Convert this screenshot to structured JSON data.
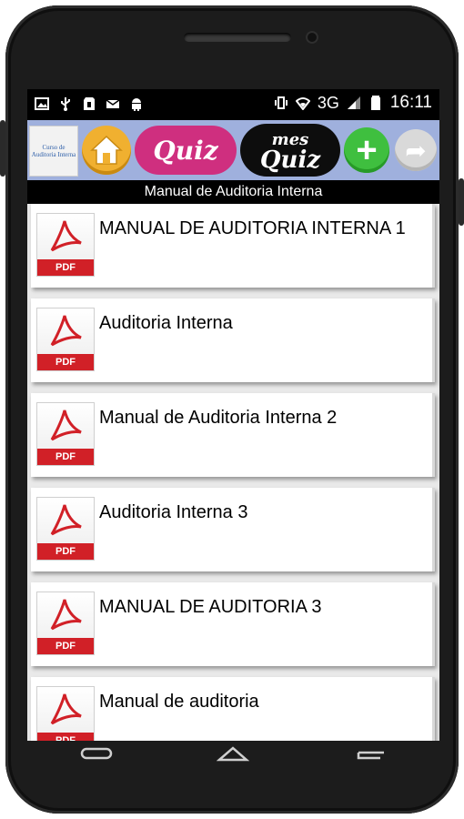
{
  "status_bar": {
    "network": "3G",
    "time": "16:11",
    "left_icons": [
      "image-icon",
      "usb-icon",
      "sd-card-icon",
      "voicemail-icon",
      "android-icon"
    ],
    "right_icons": [
      "vibrate-icon",
      "wifi-icon",
      "signal-icon",
      "battery-icon"
    ]
  },
  "toolbar": {
    "app_icon_text": "Curso de Auditoria Interna",
    "quiz_label": "Quiz",
    "mes_label": "mes",
    "mes_quiz_label": "Quiz",
    "plus_label": "+",
    "share_label": "➦"
  },
  "header": {
    "title": "Manual de Auditoria Interna"
  },
  "documents": [
    {
      "title": "MANUAL  DE  AUDITORIA INTERNA 1",
      "badge": "PDF"
    },
    {
      "title": "Auditoria Interna",
      "badge": "PDF"
    },
    {
      "title": "Manual de Auditoria Interna 2",
      "badge": "PDF"
    },
    {
      "title": "Auditoria Interna 3",
      "badge": "PDF"
    },
    {
      "title": "MANUAL DE AUDITORIA  3",
      "badge": "PDF"
    },
    {
      "title": "Manual de auditoria",
      "badge": "PDF"
    }
  ],
  "colors": {
    "toolbar_bg": "#9fb0dd",
    "quiz_pink": "#cf2f7f",
    "pdf_red": "#d12027",
    "plus_green": "#3fbf3f",
    "home_orange": "#f0b030"
  }
}
